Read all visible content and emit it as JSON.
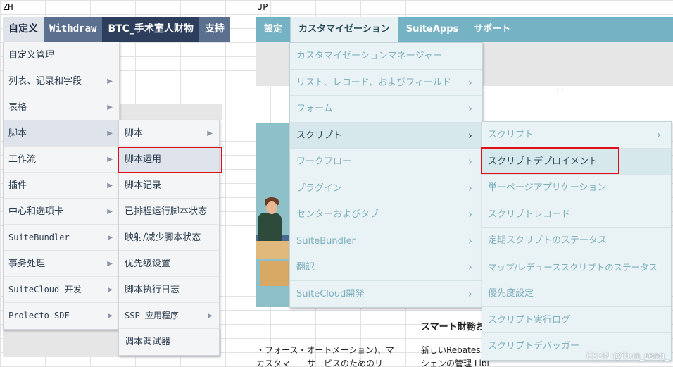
{
  "labels": {
    "zh": "ZH",
    "jp": "JP"
  },
  "zh": {
    "tabs": [
      "自定义",
      "Withdraw",
      "BTC_手术室人财物",
      "支持"
    ],
    "menu": [
      {
        "label": "自定义管理",
        "arrow": false
      },
      {
        "label": "列表、记录和字段",
        "arrow": true
      },
      {
        "label": "表格",
        "arrow": true
      },
      {
        "label": "脚本",
        "arrow": true
      },
      {
        "label": "工作流",
        "arrow": true
      },
      {
        "label": "插件",
        "arrow": true
      },
      {
        "label": "中心和选项卡",
        "arrow": true
      },
      {
        "label": "SuiteBundler",
        "arrow": true
      },
      {
        "label": "事务处理",
        "arrow": true
      },
      {
        "label": "SuiteCloud 开发",
        "arrow": true
      },
      {
        "label": "Prolecto SDF",
        "arrow": true
      }
    ],
    "submenu": [
      {
        "label": "脚本",
        "arrow": true
      },
      {
        "label": "脚本运用",
        "arrow": false
      },
      {
        "label": "脚本记录",
        "arrow": false
      },
      {
        "label": "已排程运行脚本状态",
        "arrow": false
      },
      {
        "label": "映射/减少脚本状态",
        "arrow": false
      },
      {
        "label": "优先级设置",
        "arrow": false
      },
      {
        "label": "脚本执行日志",
        "arrow": false
      },
      {
        "label": "SSP 应用程序",
        "arrow": true
      },
      {
        "label": "调本调试器",
        "arrow": false
      }
    ]
  },
  "jp": {
    "tabs": [
      "設定",
      "カスタマイゼーション",
      "SuiteApps",
      "サポート"
    ],
    "menu": [
      {
        "label": "カスタマイゼーションマネージャー",
        "arrow": false
      },
      {
        "label": "リスト、レコード、およびフィールド",
        "arrow": true
      },
      {
        "label": "フォーム",
        "arrow": true
      },
      {
        "label": "スクリプト",
        "arrow": true
      },
      {
        "label": "ワークフロー",
        "arrow": true
      },
      {
        "label": "プラグイン",
        "arrow": true
      },
      {
        "label": "センターおよびタブ",
        "arrow": true
      },
      {
        "label": "SuiteBundler",
        "arrow": true
      },
      {
        "label": "翻訳",
        "arrow": true
      },
      {
        "label": "SuiteCloud開発",
        "arrow": true
      }
    ],
    "submenu": [
      {
        "label": "スクリプト",
        "arrow": true
      },
      {
        "label": "スクリプトデプロイメント",
        "arrow": false
      },
      {
        "label": "単一ページアプリケーション",
        "arrow": false
      },
      {
        "label": "スクリプトレコード",
        "arrow": false
      },
      {
        "label": "定期スクリプトのステータス",
        "arrow": false
      },
      {
        "label": "マップ/レデューススクリプトのステータス",
        "arrow": false
      },
      {
        "label": "優先度設定",
        "arrow": false
      },
      {
        "label": "スクリプト実行ログ",
        "arrow": false
      },
      {
        "label": "スクリプトデバッガー",
        "arrow": false
      }
    ],
    "page": {
      "heading": "スマート財務お",
      "line1": "・フォース・オートメーション)、マ",
      "line2": "カスタマー　サービスのためのリ",
      "line3": "新しいRebates a",
      "line4": "シェンの管理 Libi"
    }
  },
  "watermark": "CSDN @ibun_song_",
  "colors": {
    "zh_nav": "#2c3e5c",
    "jp_nav": "#75b2c4",
    "highlight": "#e0101a"
  },
  "icons": {
    "submenu_arrow": "chevron-right-icon"
  }
}
